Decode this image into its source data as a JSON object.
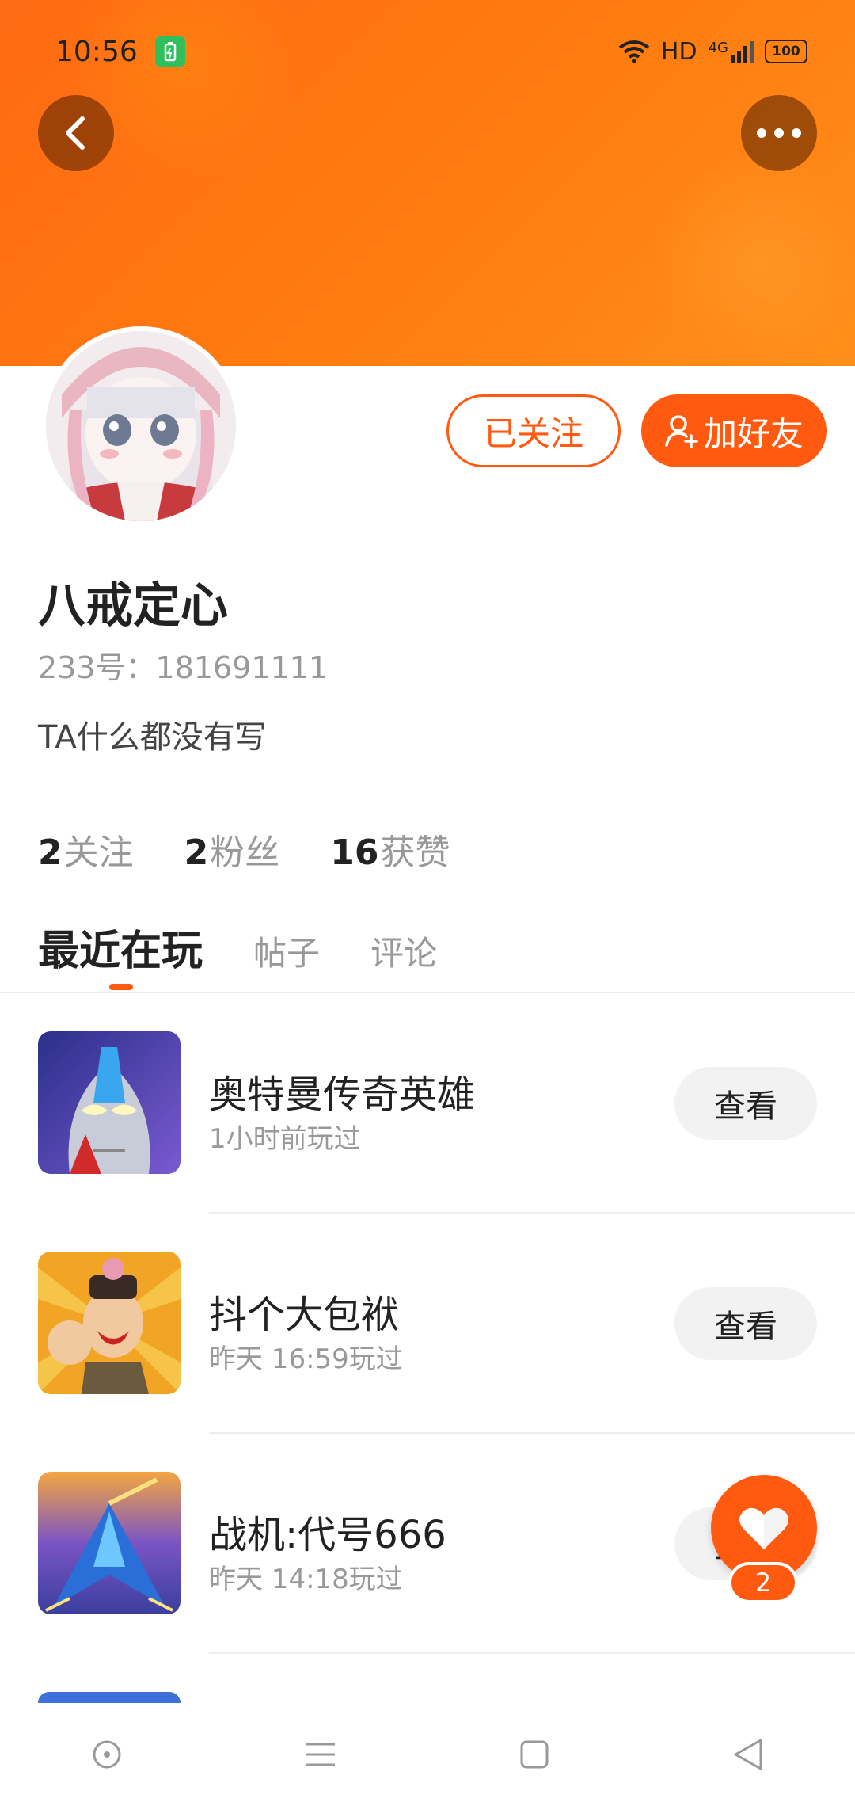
{
  "status_bar": {
    "time": "10:56",
    "network": "HD",
    "signal": "4G",
    "battery": "100"
  },
  "colors": {
    "accent": "#ff5a10",
    "banner": "#ff7a12"
  },
  "profile": {
    "name": "八戒定心",
    "uid": "233号：181691111",
    "bio": "TA什么都没有写",
    "following_label": "已关注",
    "add_friend_label": "加好友"
  },
  "stats": [
    {
      "count": "2",
      "label": "关注"
    },
    {
      "count": "2",
      "label": "粉丝"
    },
    {
      "count": "16",
      "label": "获赞"
    }
  ],
  "tabs": [
    {
      "label": "最近在玩",
      "active": true
    },
    {
      "label": "帖子",
      "active": false
    },
    {
      "label": "评论",
      "active": false
    }
  ],
  "games": [
    {
      "title": "奥特曼传奇英雄",
      "played": "1小时前玩过",
      "button": "查看"
    },
    {
      "title": "抖个大包袱",
      "played": "昨天 16:59玩过",
      "button": "查看"
    },
    {
      "title": "战机:代号666",
      "played": "昨天 14:18玩过",
      "button": "查看"
    }
  ],
  "like_fab": {
    "count": "2"
  },
  "nav_icons": [
    "home-circle-icon",
    "menu-icon",
    "square-icon",
    "back-triangle-icon"
  ]
}
